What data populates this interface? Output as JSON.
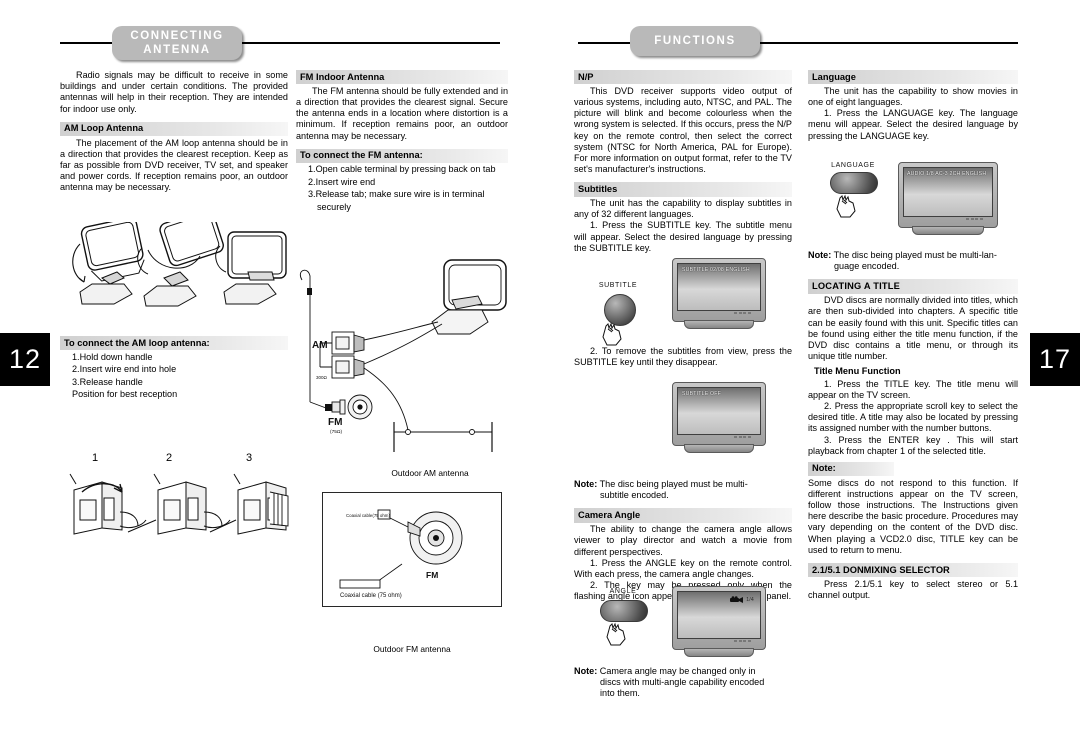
{
  "left_page": {
    "page_number": "12",
    "banner": {
      "line1": "CONNECTING",
      "line2": "ANTENNA"
    },
    "intro": "Radio signals may be difficult to receive in some buildings and under certain conditions. The provided antennas will help in their reception. They are intended for indoor use only.",
    "am_loop": {
      "heading": "AM Loop Antenna",
      "body": "The placement of the AM loop antenna should be in a direction that provides the clearest reception. Keep as far as possible from DVD receiver, TV set, and speaker and power cords. If reception remains poor, an outdoor antenna may be necessary."
    },
    "am_connect": {
      "heading": "To connect the AM loop antenna:",
      "steps": [
        "1.Hold down handle",
        "2.Insert wire end into hole",
        "3.Release handle",
        "Position for best reception"
      ]
    },
    "step_labels": [
      "1",
      "2",
      "3"
    ],
    "fm_indoor": {
      "heading": "FM Indoor Antenna",
      "body": "The FM antenna should be fully extended and in a direction that provides the clearest signal. Secure the antenna ends in a location where distortion is a minimum. If reception remains poor, an outdoor antenna may be necessary."
    },
    "fm_connect": {
      "heading": "To connect the FM antenna:",
      "steps": [
        "1.Open cable terminal by pressing back on tab",
        "2.Insert wire end",
        "3.Release tab; make sure wire is in terminal",
        "securely"
      ]
    },
    "diagram_labels": {
      "am": "AM",
      "am_ohm": "300Ω",
      "fm": "FM",
      "fm_ohm": "(75Ω)",
      "outdoor_am": "Outdoor AM antenna",
      "coax_top": "Coaxial cable (75 ohm)",
      "coax_bottom": "Coaxial cable (75 ohm)",
      "fm_disc": "FM",
      "outdoor_fm": "Outdoor FM antenna"
    }
  },
  "right_page": {
    "page_number": "17",
    "banner": {
      "line1": "FUNCTIONS",
      "line2": ""
    },
    "np": {
      "heading": "N/P",
      "body": "This DVD receiver supports video output of various systems, including auto, NTSC, and PAL. The picture will blink and become colourless when the wrong system is selected. If this occurs, press the N/P key on the remote control, then select the correct system (NTSC for North America, PAL for Europe). For more information on output format, refer to the TV set's manufacturer's instructions."
    },
    "subtitles": {
      "heading": "Subtitles",
      "body1": "The unit has the capability to display subtitles in any of 32 different languages.",
      "body2": "1. Press the SUBTITLE key. The subtitle menu will appear. Select the desired language by pressing the SUBTITLE key.",
      "key_label": "SUBTITLE",
      "osd1": "SUBTITLE 02/08 ENGLISH",
      "body3": "2. To remove the subtitles from view, press the SUBTITLE key until they disappear.",
      "osd2": "SUBTITLE OFF",
      "note_label": "Note:",
      "note_line1": "The disc being played must be multi-",
      "note_line2": "subtitle encoded."
    },
    "camera_angle": {
      "heading": "Camera Angle",
      "body1": "The ability to change the camera angle allows viewer to play director and watch a movie from different perspectives.",
      "body2": "1. Press the ANGLE key on the remote control. With each press, the camera angle changes.",
      "body3": "2. The key may be pressed only when the flashing angle icon appears in the unit's display panel.",
      "key_label": "ANGLE",
      "osd_angle": "1/4",
      "note_label": "Note:",
      "note_line1": "Camera angle may be changed only in",
      "note_line2": "discs with multi-angle capability encoded",
      "note_line3": "into them."
    },
    "language": {
      "heading": "Language",
      "body1": "The unit has the capability to show movies in one of eight languages.",
      "body2": "1. Press the LANGUAGE key. The language menu will appear. Select the desired language by pressing the LANGUAGE key.",
      "key_label": "LANGUAGE",
      "osd": "AUDIO 1/8 AC-3 2CH ENGLISH",
      "note_label": "Note:",
      "note_line1": "The disc being played must be multi-lan-",
      "note_line2": "guage encoded."
    },
    "locating_title": {
      "heading": "LOCATING A TITLE",
      "body": "DVD discs are normally divided into titles, which are then sub-divided into chapters. A specific title can be easily found with this unit. Specific titles can be found using either the title menu function, if the DVD disc contains a title menu, or through its unique title number.",
      "subheading": "Title Menu Function",
      "step1": "1. Press the TITLE key. The title menu will appear on the TV screen.",
      "step2": "2. Press the appropriate scroll key to select the desired title. A title may also be located by pressing its assigned number with the number buttons.",
      "step3": "3. Press the ENTER key . This will start playback from chapter 1 of the selected title.",
      "note_label": "Note:",
      "note_body": "Some discs do not respond to this function. If different instructions appear on the TV screen, follow those instructions. The Instructions given here describe the basic procedure. Procedures may vary depending on the content of the DVD disc. When playing a VCD2.0 disc, TITLE key can be used to return to menu."
    },
    "downmix": {
      "heading": "2.1/5.1  DONMIXING SELECTOR",
      "body": "Press 2.1/5.1 key to select stereo or 5.1 channel output."
    }
  },
  "colors": {
    "banner_pill": "#b9b9b9",
    "section_head": "#d0d0d0",
    "page_tab": "#000000",
    "text": "#000000"
  }
}
